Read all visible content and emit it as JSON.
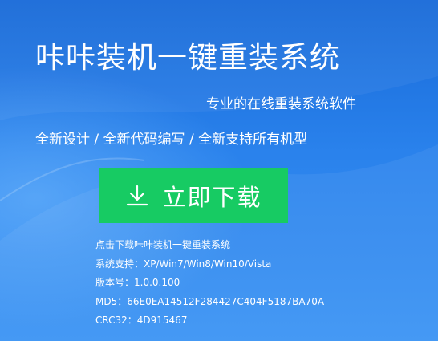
{
  "hero": {
    "title": "咔咔装机一键重装系统",
    "subtitle": "专业的在线重装系统软件",
    "features": "全新设计 / 全新代码编写 / 全新支持所有机型"
  },
  "download": {
    "label": "立即下载",
    "icon": "download-icon",
    "color": "#17cb63"
  },
  "info": {
    "link": "点击下载咔咔装机一键重装系统",
    "support": "系统支持：XP/Win7/Win8/Win10/Vista",
    "version": "版本号：1.0.0.100",
    "md5": "MD5：66E0EA14512F284427C404F5187BA70A",
    "crc32": "CRC32：4D915467"
  },
  "colors": {
    "background": "#2a82ec",
    "button": "#17cb63"
  }
}
